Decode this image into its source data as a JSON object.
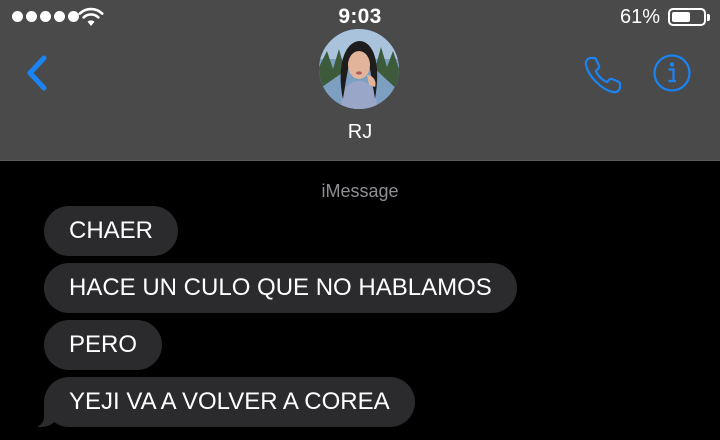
{
  "status_bar": {
    "signal_bars": 5,
    "time": "9:03",
    "battery_percent": "61%",
    "battery_level": 0.61
  },
  "header": {
    "back_icon": "chevron-left-icon",
    "contact_name": "RJ",
    "call_icon": "phone-icon",
    "info_icon": "info-icon",
    "accent_color": "#1a84f5"
  },
  "conversation": {
    "service_label": "iMessage",
    "messages": [
      {
        "text": "CHAER",
        "direction": "incoming"
      },
      {
        "text": "HACE UN CULO QUE NO HABLAMOS",
        "direction": "incoming"
      },
      {
        "text": "PERO",
        "direction": "incoming"
      },
      {
        "text": "YEJI VA A VOLVER A COREA",
        "direction": "incoming"
      }
    ]
  }
}
